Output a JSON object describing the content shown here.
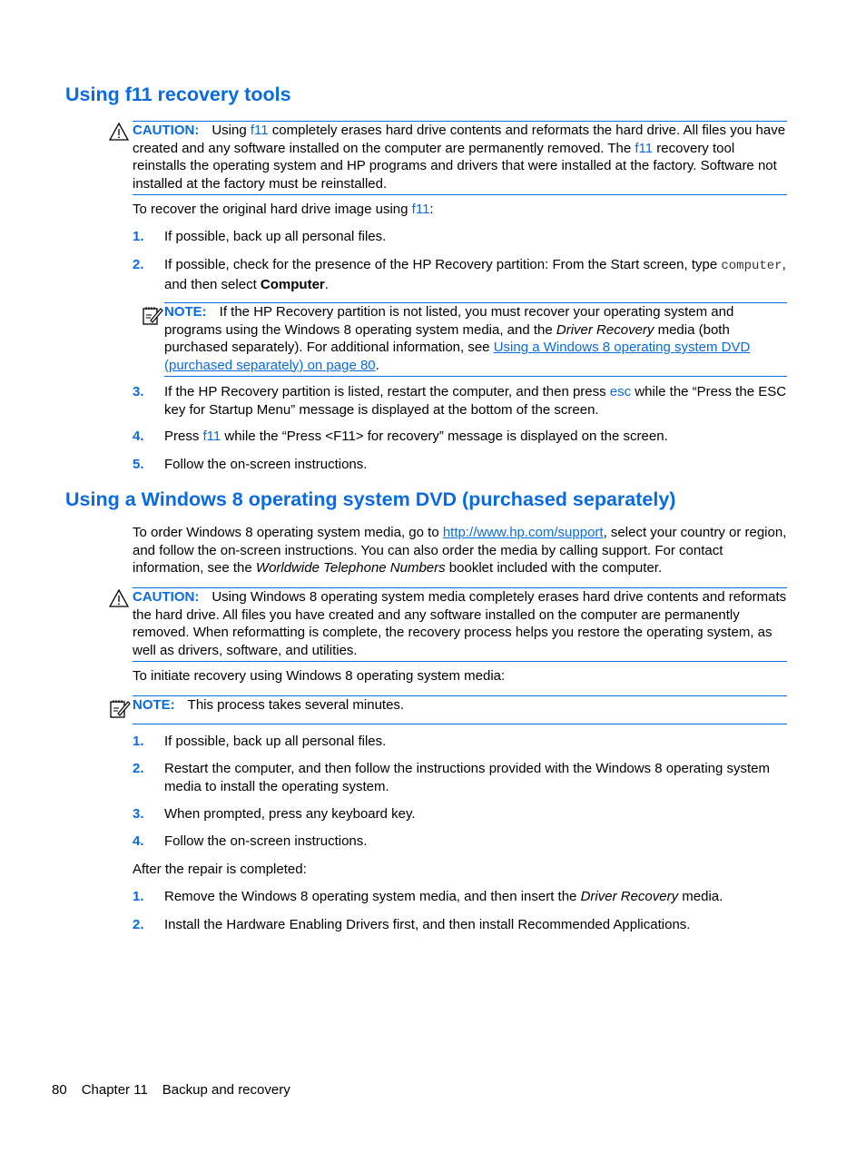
{
  "colors": {
    "accent": "#0a6be0",
    "text": "#000000"
  },
  "section1": {
    "heading": "Using f11 recovery tools",
    "caution": {
      "icon": "warning-triangle-icon",
      "label": "CAUTION:",
      "parts": [
        "Using ",
        "f11",
        " completely erases hard drive contents and reformats the hard drive. All files you have created and any software installed on the computer are permanently removed. The ",
        "f11",
        " recovery tool reinstalls the operating system and HP programs and drivers that were installed at the factory. Software not installed at the factory must be reinstalled."
      ]
    },
    "intro": [
      "To recover the original hard drive image using ",
      "f11",
      ":"
    ],
    "steps": [
      {
        "num": "1.",
        "text": "If possible, back up all personal files."
      },
      {
        "num": "2.",
        "parts": [
          "If possible, check for the presence of the HP Recovery partition: From the Start screen, type ",
          "computer",
          ", and then select ",
          "Computer",
          "."
        ]
      },
      {
        "num": "3.",
        "parts": [
          "If the HP Recovery partition is listed, restart the computer, and then press ",
          "esc",
          " while the “Press the ESC key for Startup Menu” message is displayed at the bottom of the screen."
        ]
      },
      {
        "num": "4.",
        "parts": [
          "Press ",
          "f11",
          " while the “Press <F11> for recovery” message is displayed on the screen."
        ]
      },
      {
        "num": "5.",
        "text": "Follow the on-screen instructions."
      }
    ],
    "note": {
      "icon": "note-pencil-icon",
      "label": "NOTE:",
      "parts": [
        "If the HP Recovery partition is not listed, you must recover your operating system and programs using the Windows 8 operating system media, and the ",
        "Driver Recovery",
        " media (both purchased separately). For additional information, see ",
        "Using a Windows 8 operating system DVD (purchased separately) on page 80",
        "."
      ]
    }
  },
  "section2": {
    "heading": "Using a Windows 8 operating system DVD (purchased separately)",
    "intro": [
      "To order Windows 8 operating system media, go to ",
      "http://www.hp.com/support",
      ", select your country or region, and follow the on-screen instructions. You can also order the media by calling support. For contact information, see the ",
      "Worldwide Telephone Numbers",
      " booklet included with the computer."
    ],
    "caution": {
      "icon": "warning-triangle-icon",
      "label": "CAUTION:",
      "text": "Using Windows 8 operating system media completely erases hard drive contents and reformats the hard drive. All files you have created and any software installed on the computer are permanently removed. When reformatting is complete, the recovery process helps you restore the operating system, as well as drivers, software, and utilities."
    },
    "initiate": "To initiate recovery using Windows 8 operating system media:",
    "note": {
      "icon": "note-pencil-icon",
      "label": "NOTE:",
      "text": "This process takes several minutes."
    },
    "steps": [
      {
        "num": "1.",
        "text": "If possible, back up all personal files."
      },
      {
        "num": "2.",
        "text": "Restart the computer, and then follow the instructions provided with the Windows 8 operating system media to install the operating system."
      },
      {
        "num": "3.",
        "text": "When prompted, press any keyboard key."
      },
      {
        "num": "4.",
        "text": "Follow the on-screen instructions."
      }
    ],
    "after": "After the repair is completed:",
    "after_steps": [
      {
        "num": "1.",
        "parts": [
          "Remove the Windows 8 operating system media, and then insert the ",
          "Driver Recovery",
          " media."
        ]
      },
      {
        "num": "2.",
        "text": "Install the Hardware Enabling Drivers first, and then install Recommended Applications."
      }
    ]
  },
  "footer": {
    "page": "80",
    "chapter": "Chapter 11",
    "title": "Backup and recovery"
  }
}
